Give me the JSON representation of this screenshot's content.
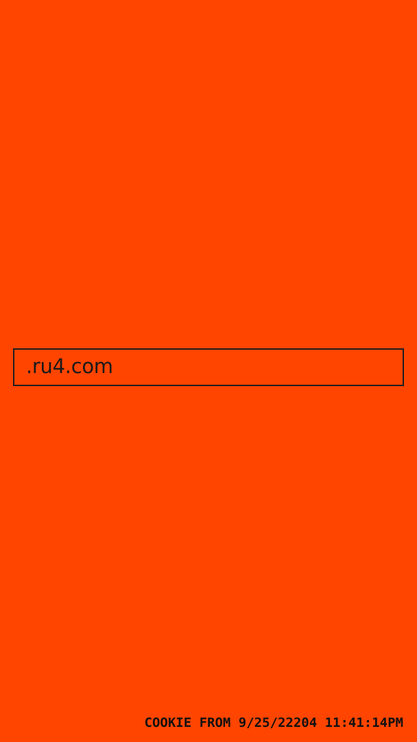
{
  "background_color": "#ff4500",
  "domain_field": {
    "value": ".ru4.com"
  },
  "footer": {
    "cookie_timestamp": "COOKIE FROM 9/25/22204 11:41:14PM"
  }
}
